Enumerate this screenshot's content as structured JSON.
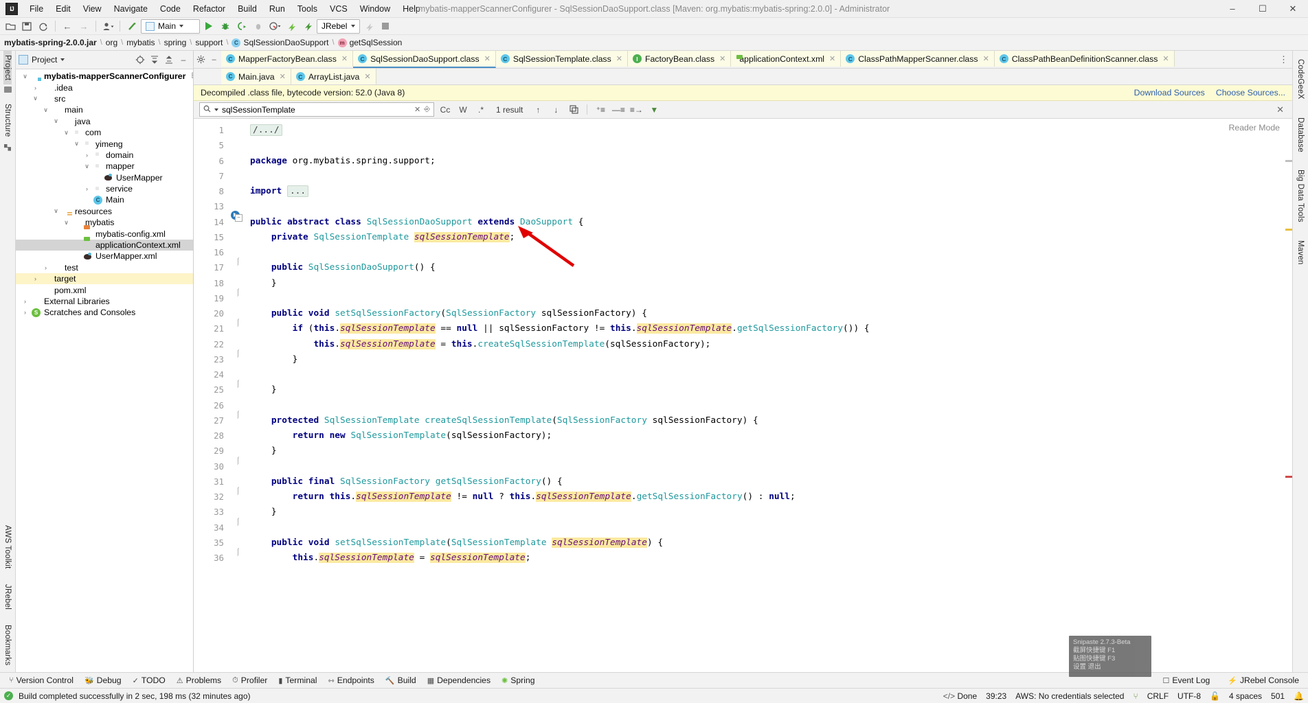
{
  "window": {
    "title": "mybatis-mapperScannerConfigurer - SqlSessionDaoSupport.class [Maven: org.mybatis:mybatis-spring:2.0.0] - Administrator",
    "logo": "IJ",
    "minimize": "–",
    "maximize": "☐",
    "close": "✕"
  },
  "menu": [
    "File",
    "Edit",
    "View",
    "Navigate",
    "Code",
    "Refactor",
    "Build",
    "Run",
    "Tools",
    "VCS",
    "Window",
    "Help"
  ],
  "toolbar": {
    "open_label": "open-folder",
    "save_label": "save-all",
    "sync_label": "sync",
    "back_label": "←",
    "forward_label": "→",
    "profile_label": "user",
    "run_config": "Main",
    "jrebel": "JRebel",
    "run": "run",
    "debug": "debug",
    "coverage": "coverage",
    "stop": "stop"
  },
  "breadcrumb": [
    {
      "label": "mybatis-spring-2.0.0.jar",
      "icon": null
    },
    {
      "label": "org",
      "icon": null
    },
    {
      "label": "mybatis",
      "icon": null
    },
    {
      "label": "spring",
      "icon": null
    },
    {
      "label": "support",
      "icon": null
    },
    {
      "label": "SqlSessionDaoSupport",
      "icon": "class-icon"
    },
    {
      "label": "getSqlSession",
      "icon": "method-icon"
    }
  ],
  "left_rail": {
    "project": "Project",
    "structure": "Structure",
    "bookmarks": "Bookmarks",
    "jrebel": "JRebel",
    "aws": "AWS Toolkit"
  },
  "right_rail": {
    "codegeex": "CodeGeeX",
    "database": "Database",
    "bigdata": "Big Data Tools",
    "maven": "Maven"
  },
  "project_panel": {
    "title": "Project",
    "buttons": [
      "target-icon",
      "collapse-all-icon",
      "expand-icon",
      "minimize-icon"
    ],
    "tree": [
      {
        "depth": 0,
        "arrow": "∨",
        "icon": "module-folder",
        "label": "mybatis-mapperScannerConfigurer",
        "bold": true,
        "path": "E:\\mybati",
        "state": "none"
      },
      {
        "depth": 1,
        "arrow": "›",
        "icon": "folder",
        "label": ".idea",
        "state": "none"
      },
      {
        "depth": 1,
        "arrow": "∨",
        "icon": "folder",
        "label": "src",
        "state": "none"
      },
      {
        "depth": 2,
        "arrow": "∨",
        "icon": "folder",
        "label": "main",
        "state": "none"
      },
      {
        "depth": 3,
        "arrow": "∨",
        "icon": "source-folder",
        "label": "java",
        "state": "none"
      },
      {
        "depth": 4,
        "arrow": "∨",
        "icon": "package",
        "label": "com",
        "state": "none"
      },
      {
        "depth": 5,
        "arrow": "∨",
        "icon": "package",
        "label": "yimeng",
        "state": "none"
      },
      {
        "depth": 6,
        "arrow": "›",
        "icon": "package",
        "label": "domain",
        "state": "none"
      },
      {
        "depth": 6,
        "arrow": "∨",
        "icon": "package",
        "label": "mapper",
        "state": "none"
      },
      {
        "depth": 7,
        "arrow": "",
        "icon": "mybatis-mapper",
        "label": "UserMapper",
        "state": "none"
      },
      {
        "depth": 6,
        "arrow": "›",
        "icon": "package",
        "label": "service",
        "state": "none"
      },
      {
        "depth": 6,
        "arrow": "",
        "icon": "java-class-run",
        "label": "Main",
        "state": "none"
      },
      {
        "depth": 3,
        "arrow": "∨",
        "icon": "resources-folder",
        "label": "resources",
        "state": "none"
      },
      {
        "depth": 4,
        "arrow": "∨",
        "icon": "folder",
        "label": "mybatis",
        "state": "none"
      },
      {
        "depth": 5,
        "arrow": "",
        "icon": "xml-file",
        "label": "mybatis-config.xml",
        "state": "none"
      },
      {
        "depth": 5,
        "arrow": "",
        "icon": "spring-xml-file",
        "label": "applicationContext.xml",
        "state": "selected"
      },
      {
        "depth": 5,
        "arrow": "",
        "icon": "mybatis-mapper",
        "label": "UserMapper.xml",
        "state": "none"
      },
      {
        "depth": 2,
        "arrow": "›",
        "icon": "folder",
        "label": "test",
        "state": "none"
      },
      {
        "depth": 1,
        "arrow": "›",
        "icon": "target-folder",
        "label": "target",
        "state": "highlight"
      },
      {
        "depth": 1,
        "arrow": "",
        "icon": "maven-file",
        "label": "pom.xml",
        "state": "none"
      },
      {
        "depth": 0,
        "arrow": "›",
        "icon": "libraries",
        "label": "External Libraries",
        "state": "none"
      },
      {
        "depth": 0,
        "arrow": "›",
        "icon": "scratches",
        "label": "Scratches and Consoles",
        "state": "none"
      }
    ]
  },
  "editor_tabs_row1": [
    {
      "label": "MapperFactoryBean.class",
      "icon": "class-icon",
      "active": false
    },
    {
      "label": "SqlSessionDaoSupport.class",
      "icon": "class-icon",
      "active": true
    },
    {
      "label": "SqlSessionTemplate.class",
      "icon": "class-icon",
      "active": false
    },
    {
      "label": "FactoryBean.class",
      "icon": "interface-icon",
      "active": false
    },
    {
      "label": "applicationContext.xml",
      "icon": "spring-xml-icon",
      "active": false
    },
    {
      "label": "ClassPathMapperScanner.class",
      "icon": "class-icon",
      "active": false
    },
    {
      "label": "ClassPathBeanDefinitionScanner.class",
      "icon": "class-icon",
      "active": false
    }
  ],
  "editor_tabs_row2": [
    {
      "label": "Main.java",
      "icon": "java-class-run-icon",
      "active": false
    },
    {
      "label": "ArrayList.java",
      "icon": "class-icon",
      "active": false
    }
  ],
  "notice": {
    "text": "Decompiled .class file, bytecode version: 52.0 (Java 8)",
    "download_sources": "Download Sources",
    "choose_sources": "Choose Sources..."
  },
  "findbar": {
    "query": "sqlSessionTemplate",
    "results": "1 result",
    "case_label": "Cc",
    "words_label": "W",
    "regex_label": ".*",
    "prev": "↑",
    "next": "↓",
    "close": "✕"
  },
  "reader_mode": "Reader Mode",
  "code": {
    "first_line_number": 1,
    "line_numbers": [
      1,
      5,
      6,
      7,
      8,
      13,
      14,
      15,
      16,
      17,
      18,
      19,
      20,
      21,
      22,
      23,
      24,
      25,
      26,
      27,
      28,
      29,
      30,
      31,
      32,
      33,
      34,
      35,
      36
    ],
    "lines": [
      "/.../",
      "",
      "package org.mybatis.spring.support;",
      "",
      "import ...",
      "",
      "public abstract class SqlSessionDaoSupport extends DaoSupport {",
      "    private SqlSessionTemplate sqlSessionTemplate;",
      "",
      "    public SqlSessionDaoSupport() {",
      "    }",
      "",
      "    public void setSqlSessionFactory(SqlSessionFactory sqlSessionFactory) {",
      "        if (this.sqlSessionTemplate == null || sqlSessionFactory != this.sqlSessionTemplate.getSqlSessionFactory()) {",
      "            this.sqlSessionTemplate = this.createSqlSessionTemplate(sqlSessionFactory);",
      "        }",
      "",
      "    }",
      "",
      "    protected SqlSessionTemplate createSqlSessionTemplate(SqlSessionFactory sqlSessionFactory) {",
      "        return new SqlSessionTemplate(sqlSessionFactory);",
      "    }",
      "",
      "    public final SqlSessionFactory getSqlSessionFactory() {",
      "        return this.sqlSessionTemplate != null ? this.sqlSessionTemplate.getSqlSessionFactory() : null;",
      "    }",
      "",
      "    public void setSqlSessionTemplate(SqlSessionTemplate sqlSessionTemplate) {",
      "        this.sqlSessionTemplate = sqlSessionTemplate;"
    ]
  },
  "bottom_bar": {
    "left": [
      {
        "label": "Version Control",
        "icon": "branch-icon"
      },
      {
        "label": "Debug",
        "icon": "bug-icon"
      },
      {
        "label": "TODO",
        "icon": "check-icon"
      },
      {
        "label": "Problems",
        "icon": "warning-icon"
      },
      {
        "label": "Profiler",
        "icon": "gauge-icon"
      },
      {
        "label": "Terminal",
        "icon": "terminal-icon"
      },
      {
        "label": "Endpoints",
        "icon": "endpoints-icon"
      },
      {
        "label": "Build",
        "icon": "hammer-icon"
      },
      {
        "label": "Dependencies",
        "icon": "dependencies-icon"
      },
      {
        "label": "Spring",
        "icon": "spring-icon"
      }
    ],
    "right": [
      {
        "label": "Event Log",
        "icon": "event-log-icon"
      },
      {
        "label": "JRebel Console",
        "icon": "jrebel-icon"
      }
    ]
  },
  "status_bar": {
    "build_message": "Build completed successfully in 2 sec, 198 ms (32 minutes ago)",
    "done": "Done",
    "caret": "39:23",
    "aws": "AWS: No credentials selected",
    "line_sep": "CRLF",
    "encoding": "UTF-8",
    "indent": "4 spaces",
    "memory": "501"
  },
  "snipaste": {
    "title": "Snipaste 2.7.3-Beta",
    "line1": "截屏快捷键  F1",
    "line2": "贴图快捷键  F3",
    "line3": "设置  退出"
  },
  "colors": {
    "accent": "#2e7ab8",
    "keyword": "#000080",
    "type": "#20999d",
    "field": "#660e7a",
    "highlight": "#fbe9a0",
    "tab_active": "#fdfde8",
    "notice_bg": "#fdfbd4",
    "arrow_red": "#e00000"
  }
}
